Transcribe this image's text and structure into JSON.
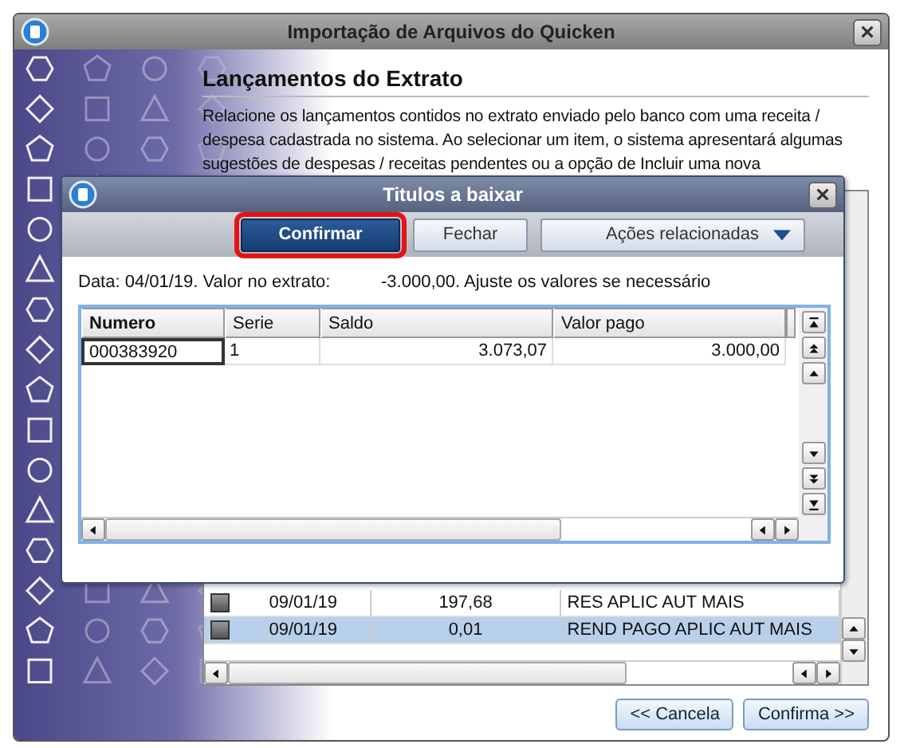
{
  "window": {
    "title": "Importação de Arquivos do Quicken"
  },
  "heading": "Lançamentos do Extrato",
  "description": "Relacione os lançamentos contidos no extrato enviado pelo banco com uma receita / despesa cadastrada no sistema. Ao selecionar um item, o sistema apresentará algumas sugestões de despesas / receitas pendentes ou a opção de Incluir uma nova",
  "list": {
    "rows": [
      {
        "checked": false,
        "selected": false,
        "date": "09/01/19",
        "value": "197,68",
        "description": "RES APLIC AUT MAIS"
      },
      {
        "checked": false,
        "selected": true,
        "date": "09/01/19",
        "value": "0,01",
        "description": "REND PAGO APLIC AUT MAIS"
      }
    ]
  },
  "buttons": [
    {
      "label": "<< Cancela"
    },
    {
      "label": "Confirma >>"
    }
  ],
  "dialog": {
    "title": "Titulos a baixar",
    "toolbar": [
      {
        "label": "Confirmar",
        "kind": "primary",
        "highlighted": true
      },
      {
        "label": "Fechar",
        "kind": "normal",
        "highlighted": false
      },
      {
        "label": "Ações relacionadas",
        "kind": "menu",
        "highlighted": false
      }
    ],
    "info_label": "Data: 04/01/19. Valor no extrato:",
    "info_value": "-3.000,00. Ajuste os valores se necessário",
    "table": {
      "columns": [
        {
          "label": "Numero",
          "sorted": true
        },
        {
          "label": "Serie",
          "sorted": false
        },
        {
          "label": "Saldo",
          "sorted": false
        },
        {
          "label": "Valor pago",
          "sorted": false
        }
      ],
      "rows": [
        {
          "current": true,
          "cells": [
            "000383920",
            "1",
            "3.073,07",
            "3.000,00"
          ]
        }
      ]
    }
  }
}
